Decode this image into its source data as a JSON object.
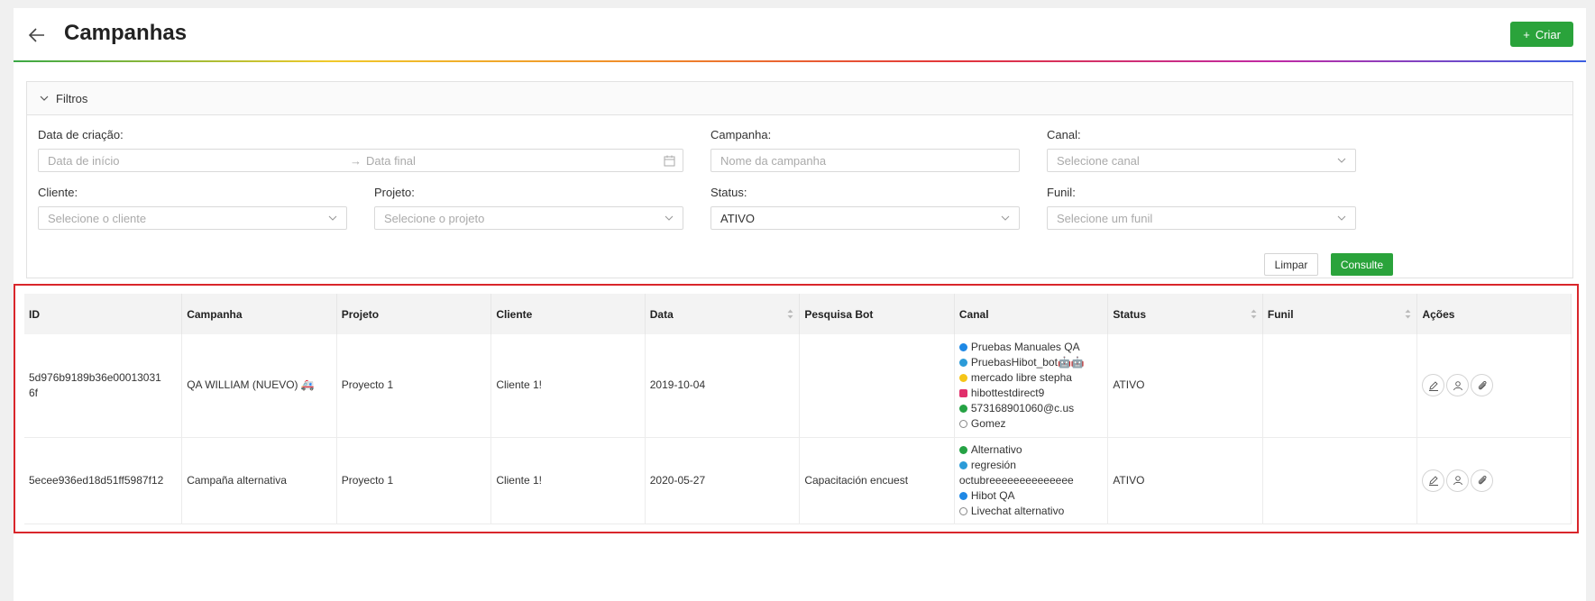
{
  "header": {
    "title": "Campanhas",
    "create_label": "Criar"
  },
  "filters": {
    "toggle_label": "Filtros",
    "date_label": "Data de criação",
    "date_start_placeholder": "Data de início",
    "date_end_placeholder": "Data final",
    "campaign_label": "Campanha",
    "campaign_placeholder": "Nome da campanha",
    "channel_label": "Canal",
    "channel_placeholder": "Selecione canal",
    "client_label": "Cliente",
    "client_placeholder": "Selecione o cliente",
    "project_label": "Projeto",
    "project_placeholder": "Selecione o projeto",
    "status_label": "Status",
    "status_value": "ATIVO",
    "funnel_label": "Funil",
    "funnel_placeholder": "Selecione um funil",
    "clear_label": "Limpar",
    "query_label": "Consulte"
  },
  "table": {
    "columns": [
      "ID",
      "Campanha",
      "Projeto",
      "Cliente",
      "Data",
      "Pesquisa Bot",
      "Canal",
      "Status",
      "Funil",
      "Ações"
    ],
    "rows": [
      {
        "id": "5d976b9189b36e000130316f",
        "id_line1": "5d976b9189b36e00013031",
        "id_line2": "6f",
        "campaign": "QA WILLIAM (NUEVO) 🚑",
        "project": "Proyecto 1",
        "client": "Cliente 1!",
        "date": "2019-10-04",
        "bot": "",
        "channels": [
          {
            "name": "Pruebas Manuales QA",
            "icon": "messenger-icon",
            "color": "#1e88e5"
          },
          {
            "name": "PruebasHibot_bot🤖🤖",
            "icon": "telegram-icon",
            "color": "#2b9bd8"
          },
          {
            "name": "mercado libre stepha",
            "icon": "mercadolibre-icon",
            "color": "#f5c518"
          },
          {
            "name": "hibottestdirect9",
            "icon": "instagram-icon",
            "color": "#e1306c"
          },
          {
            "name": "573168901060@c.us",
            "icon": "whatsapp-icon",
            "color": "#25a244"
          },
          {
            "name": "Gomez",
            "icon": "livechat-icon",
            "color": "#888888"
          }
        ],
        "status": "ATIVO",
        "funnel": ""
      },
      {
        "id": "5ecee936ed18d51ff5987f12",
        "campaign": "Campaña alternativa",
        "project": "Proyecto 1",
        "client": "Cliente 1!",
        "date": "2020-05-27",
        "bot": "Capacitación encuest",
        "channels": [
          {
            "name": "Alternativo",
            "icon": "whatsapp-icon",
            "color": "#25a244"
          },
          {
            "name": "regresión octubreeeeeeeeeeeeee",
            "name_line1": "regresión",
            "name_line2": "octubreeeeeeeeeeeeee",
            "icon": "telegram-icon",
            "color": "#2b9bd8"
          },
          {
            "name": "Hibot QA",
            "icon": "messenger-icon",
            "color": "#1e88e5"
          },
          {
            "name": "Livechat alternativo",
            "icon": "livechat-icon",
            "color": "#888888"
          }
        ],
        "status": "ATIVO",
        "funnel": ""
      }
    ]
  },
  "colors": {
    "primary_green": "#2aa33b",
    "highlight_red": "#d9262b"
  }
}
